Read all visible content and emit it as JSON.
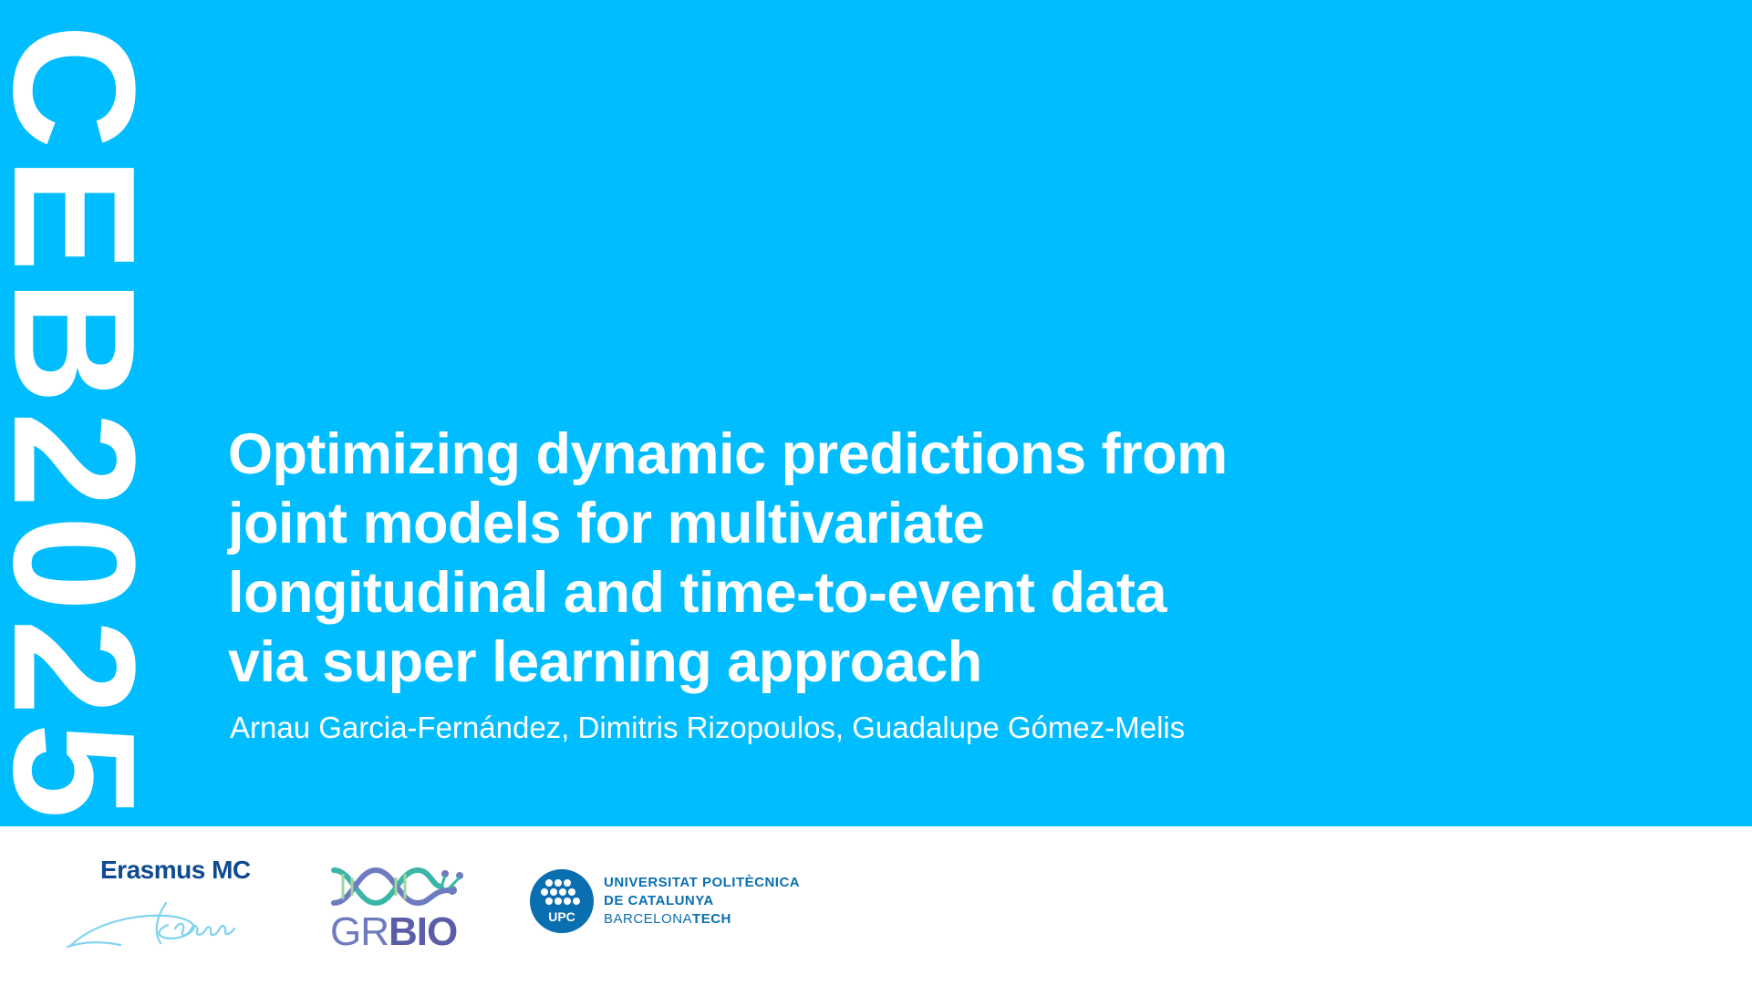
{
  "slide": {
    "brand": "CEB2025",
    "title_lines": [
      "Optimizing dynamic predictions from",
      "joint models for multivariate",
      "longitudinal and time-to-event data",
      "via super learning approach"
    ],
    "authors": "Arnau Garcia-Fernández, Dimitris Rizopoulos, Guadalupe Gómez-Melis"
  },
  "logos": {
    "erasmus": {
      "name": "Erasmus MC"
    },
    "grbio": {
      "gr": "GR",
      "bio": "BIO"
    },
    "upc": {
      "seal_text": "UPC",
      "line1": "UNIVERSITAT POLITÈCNICA",
      "line2": "DE CATALUNYA",
      "line3_a": "BARCELONA",
      "line3_b": "TECH"
    }
  },
  "colors": {
    "panel": "#00BDFF",
    "text": "#FFFFFF",
    "erasmus": "#0D4A8F",
    "grbio_teal": "#3BB5A8",
    "grbio_purple": "#5B5EA6",
    "upc_blue": "#0A6FB0"
  }
}
